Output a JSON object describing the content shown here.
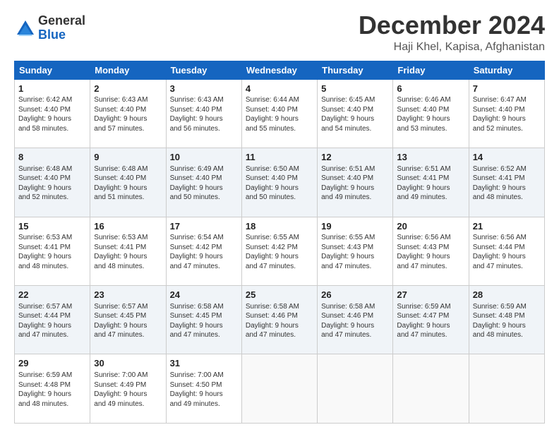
{
  "header": {
    "logo_line1": "General",
    "logo_line2": "Blue",
    "month": "December 2024",
    "location": "Haji Khel, Kapisa, Afghanistan"
  },
  "weekdays": [
    "Sunday",
    "Monday",
    "Tuesday",
    "Wednesday",
    "Thursday",
    "Friday",
    "Saturday"
  ],
  "weeks": [
    [
      {
        "day": "1",
        "info": "Sunrise: 6:42 AM\nSunset: 4:40 PM\nDaylight: 9 hours\nand 58 minutes."
      },
      {
        "day": "2",
        "info": "Sunrise: 6:43 AM\nSunset: 4:40 PM\nDaylight: 9 hours\nand 57 minutes."
      },
      {
        "day": "3",
        "info": "Sunrise: 6:43 AM\nSunset: 4:40 PM\nDaylight: 9 hours\nand 56 minutes."
      },
      {
        "day": "4",
        "info": "Sunrise: 6:44 AM\nSunset: 4:40 PM\nDaylight: 9 hours\nand 55 minutes."
      },
      {
        "day": "5",
        "info": "Sunrise: 6:45 AM\nSunset: 4:40 PM\nDaylight: 9 hours\nand 54 minutes."
      },
      {
        "day": "6",
        "info": "Sunrise: 6:46 AM\nSunset: 4:40 PM\nDaylight: 9 hours\nand 53 minutes."
      },
      {
        "day": "7",
        "info": "Sunrise: 6:47 AM\nSunset: 4:40 PM\nDaylight: 9 hours\nand 52 minutes."
      }
    ],
    [
      {
        "day": "8",
        "info": "Sunrise: 6:48 AM\nSunset: 4:40 PM\nDaylight: 9 hours\nand 52 minutes."
      },
      {
        "day": "9",
        "info": "Sunrise: 6:48 AM\nSunset: 4:40 PM\nDaylight: 9 hours\nand 51 minutes."
      },
      {
        "day": "10",
        "info": "Sunrise: 6:49 AM\nSunset: 4:40 PM\nDaylight: 9 hours\nand 50 minutes."
      },
      {
        "day": "11",
        "info": "Sunrise: 6:50 AM\nSunset: 4:40 PM\nDaylight: 9 hours\nand 50 minutes."
      },
      {
        "day": "12",
        "info": "Sunrise: 6:51 AM\nSunset: 4:40 PM\nDaylight: 9 hours\nand 49 minutes."
      },
      {
        "day": "13",
        "info": "Sunrise: 6:51 AM\nSunset: 4:41 PM\nDaylight: 9 hours\nand 49 minutes."
      },
      {
        "day": "14",
        "info": "Sunrise: 6:52 AM\nSunset: 4:41 PM\nDaylight: 9 hours\nand 48 minutes."
      }
    ],
    [
      {
        "day": "15",
        "info": "Sunrise: 6:53 AM\nSunset: 4:41 PM\nDaylight: 9 hours\nand 48 minutes."
      },
      {
        "day": "16",
        "info": "Sunrise: 6:53 AM\nSunset: 4:41 PM\nDaylight: 9 hours\nand 48 minutes."
      },
      {
        "day": "17",
        "info": "Sunrise: 6:54 AM\nSunset: 4:42 PM\nDaylight: 9 hours\nand 47 minutes."
      },
      {
        "day": "18",
        "info": "Sunrise: 6:55 AM\nSunset: 4:42 PM\nDaylight: 9 hours\nand 47 minutes."
      },
      {
        "day": "19",
        "info": "Sunrise: 6:55 AM\nSunset: 4:43 PM\nDaylight: 9 hours\nand 47 minutes."
      },
      {
        "day": "20",
        "info": "Sunrise: 6:56 AM\nSunset: 4:43 PM\nDaylight: 9 hours\nand 47 minutes."
      },
      {
        "day": "21",
        "info": "Sunrise: 6:56 AM\nSunset: 4:44 PM\nDaylight: 9 hours\nand 47 minutes."
      }
    ],
    [
      {
        "day": "22",
        "info": "Sunrise: 6:57 AM\nSunset: 4:44 PM\nDaylight: 9 hours\nand 47 minutes."
      },
      {
        "day": "23",
        "info": "Sunrise: 6:57 AM\nSunset: 4:45 PM\nDaylight: 9 hours\nand 47 minutes."
      },
      {
        "day": "24",
        "info": "Sunrise: 6:58 AM\nSunset: 4:45 PM\nDaylight: 9 hours\nand 47 minutes."
      },
      {
        "day": "25",
        "info": "Sunrise: 6:58 AM\nSunset: 4:46 PM\nDaylight: 9 hours\nand 47 minutes."
      },
      {
        "day": "26",
        "info": "Sunrise: 6:58 AM\nSunset: 4:46 PM\nDaylight: 9 hours\nand 47 minutes."
      },
      {
        "day": "27",
        "info": "Sunrise: 6:59 AM\nSunset: 4:47 PM\nDaylight: 9 hours\nand 47 minutes."
      },
      {
        "day": "28",
        "info": "Sunrise: 6:59 AM\nSunset: 4:48 PM\nDaylight: 9 hours\nand 48 minutes."
      }
    ],
    [
      {
        "day": "29",
        "info": "Sunrise: 6:59 AM\nSunset: 4:48 PM\nDaylight: 9 hours\nand 48 minutes."
      },
      {
        "day": "30",
        "info": "Sunrise: 7:00 AM\nSunset: 4:49 PM\nDaylight: 9 hours\nand 49 minutes."
      },
      {
        "day": "31",
        "info": "Sunrise: 7:00 AM\nSunset: 4:50 PM\nDaylight: 9 hours\nand 49 minutes."
      },
      {
        "day": "",
        "info": ""
      },
      {
        "day": "",
        "info": ""
      },
      {
        "day": "",
        "info": ""
      },
      {
        "day": "",
        "info": ""
      }
    ]
  ]
}
